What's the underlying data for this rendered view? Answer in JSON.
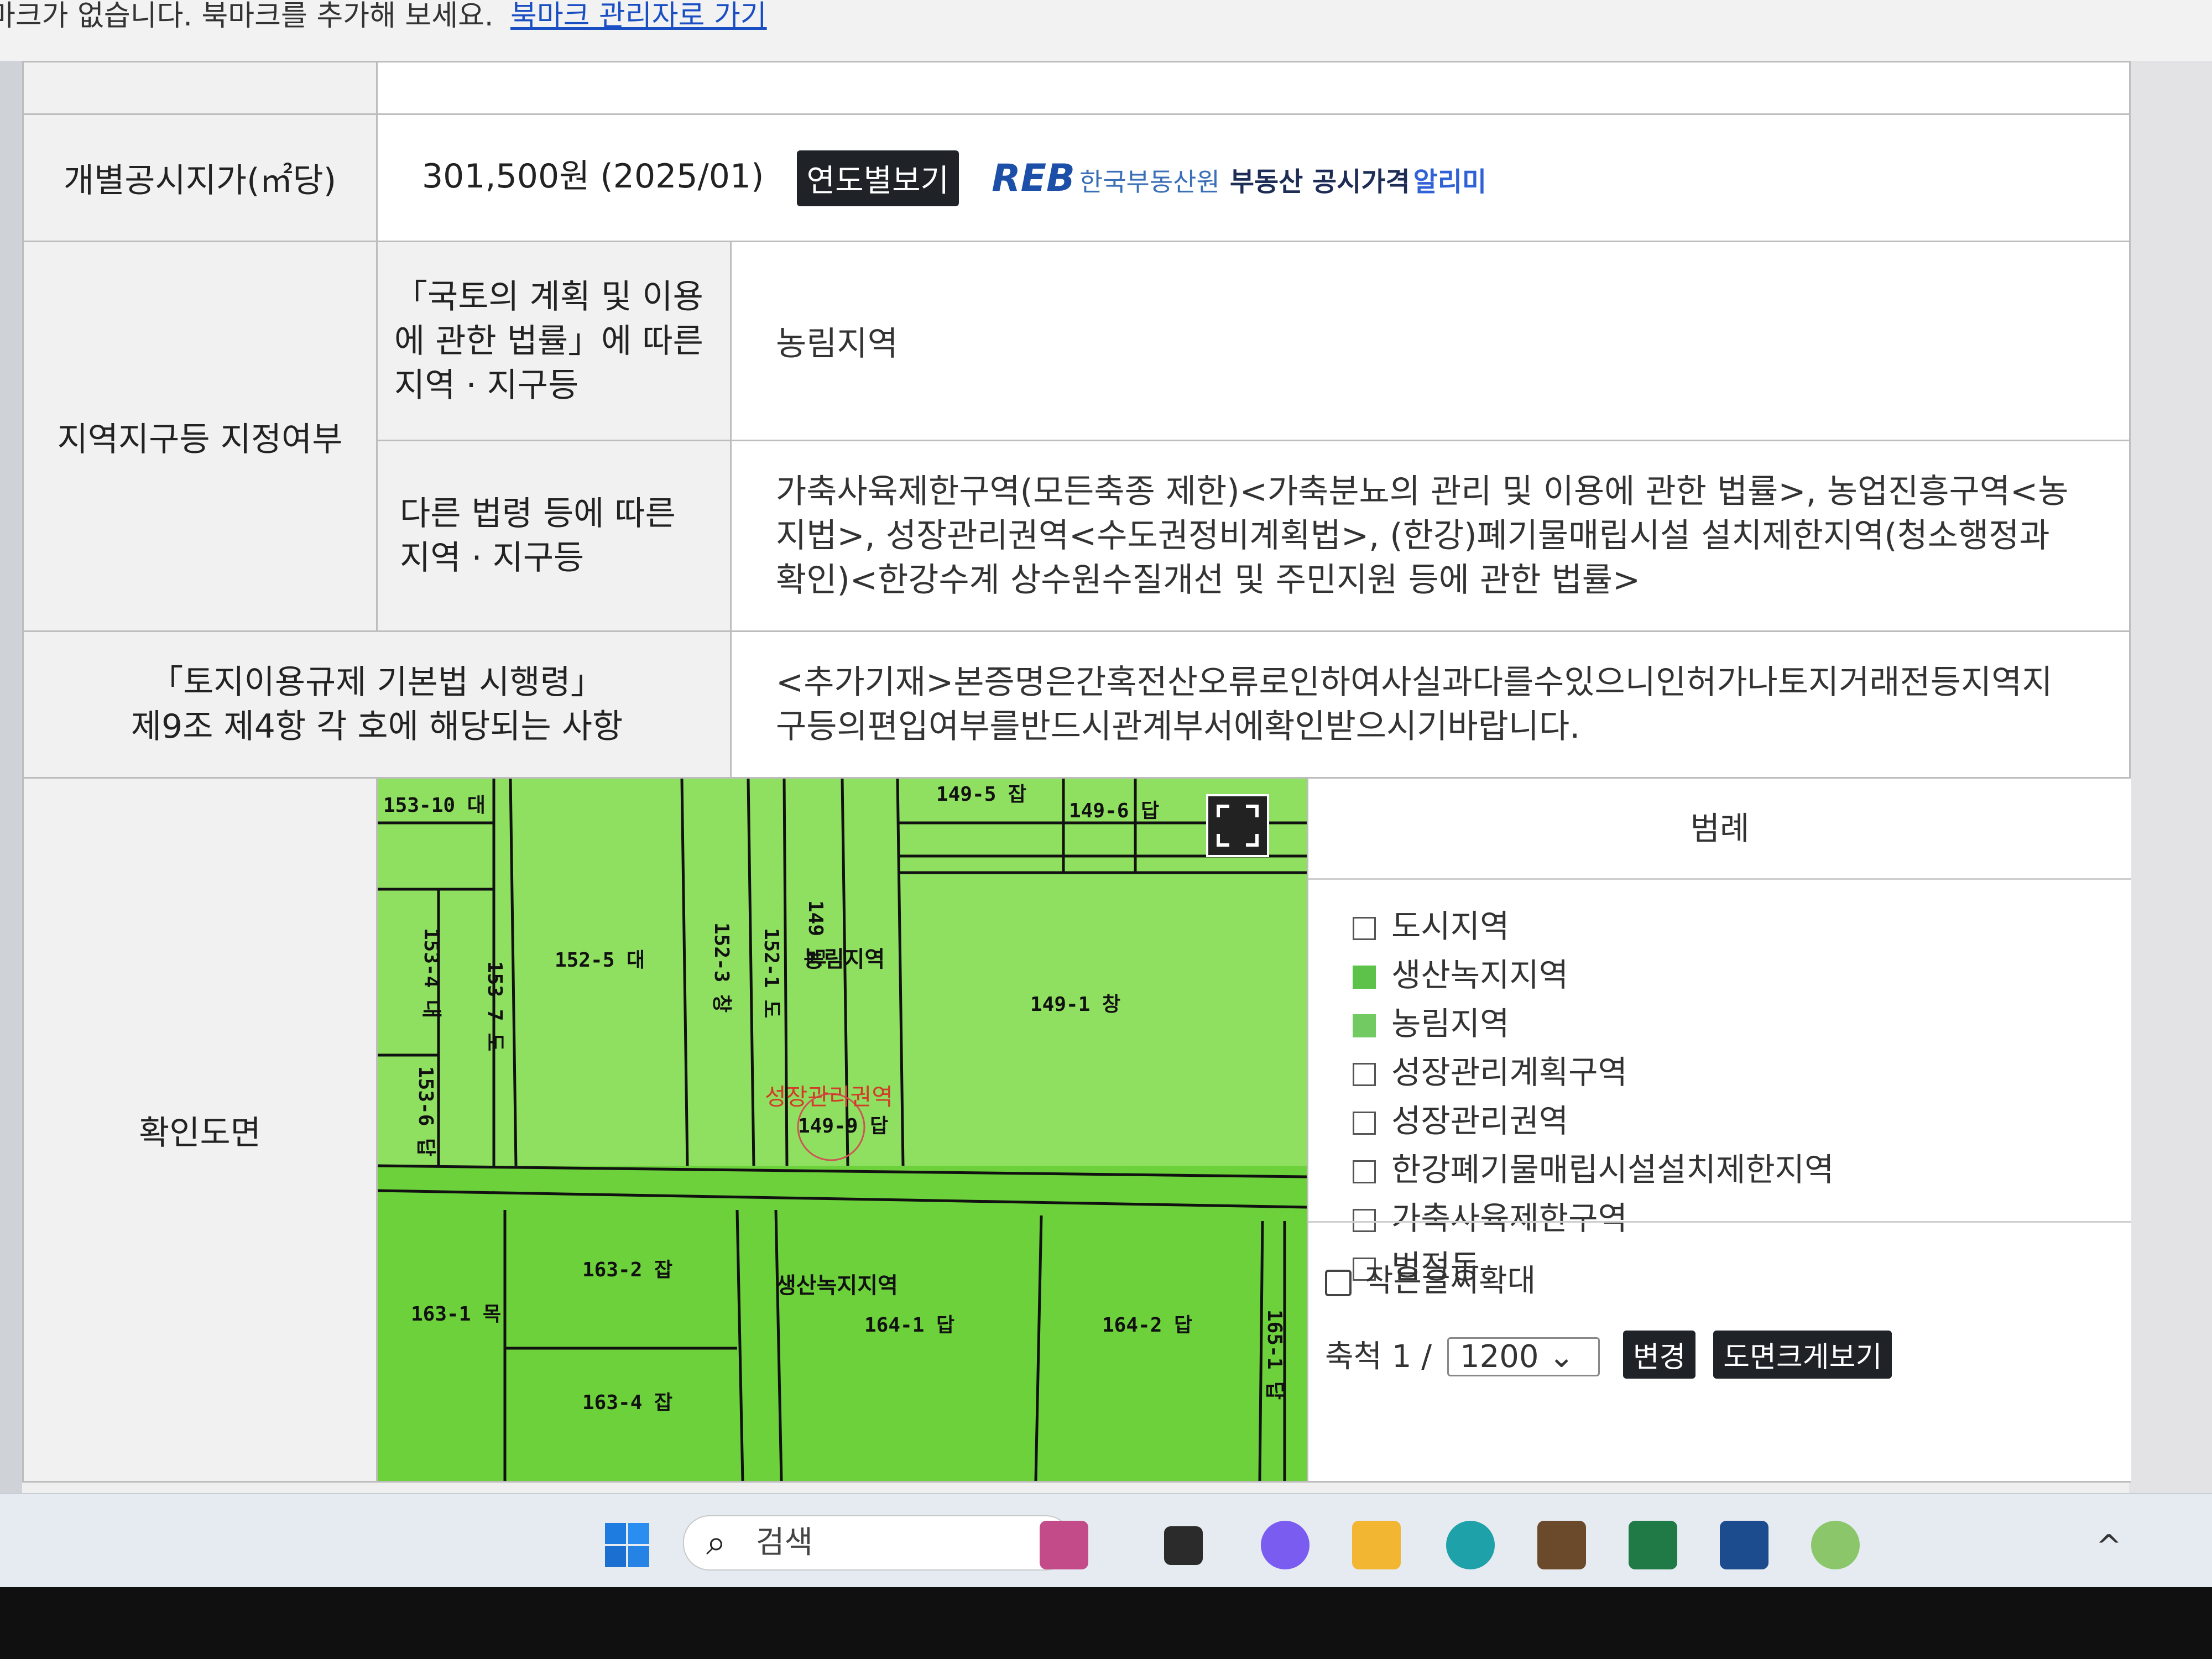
{
  "bookmark_bar": {
    "message": "마크가 없습니다. 북마크를 추가해 보세요.",
    "link": "북마크 관리자로 가기"
  },
  "land": {
    "official_price_label": "개별공시지가(㎡당)",
    "official_price_value": "301,500원 (2025/01)",
    "year_view_button": "연도별보기",
    "reb_logo": "REB",
    "reb_org": "한국부동산원",
    "reb_service": "부동산 공시가격",
    "reb_service_suffix": "알리미",
    "zoning_label": "지역지구등 지정여부",
    "national_law_label": "「국토의 계획 및 이용에 관한 법률」에 따른 지역 · 지구등",
    "national_law_value": "농림지역",
    "other_law_label": "다른 법령 등에 따른 지역 · 지구등",
    "other_law_value": "가축사육제한구역(모든축종 제한)<가축분뇨의 관리 및 이용에 관한 법률>, 농업진흥구역<농지법>, 성장관리권역<수도권정비계획법>, (한강)폐기물매립시설 설치제한지역(청소행정과 확인)<한강수계 상수원수질개선 및 주민지원 등에 관한 법률>",
    "regulation_label_line1": "「토지이용규제 기본법 시행령」",
    "regulation_label_line2": "제9조 제4항 각 호에 해당되는 사항",
    "regulation_value": "<추가기재>본증명은간혹전산오류로인하여사실과다를수있으니인허가나토지거래전등지역지구등의편입여부를반드시관계부서에확인받으시기바랍니다.",
    "map_label": "확인도면"
  },
  "map": {
    "parcels": [
      "153-10 대",
      "152-5 대",
      "152-3 창",
      "152-1 도",
      "149 답",
      "149-5 잡",
      "149-6 답",
      "149-1 창",
      "153-4 대",
      "153-7 도",
      "153-6 답",
      "149-9 답",
      "163-2 잡",
      "163-1 목",
      "163-4 잡",
      "164-1 답",
      "164-2 답",
      "165-1 답"
    ],
    "zone_labels": [
      "농림지역",
      "성장관리권역",
      "생산녹지지역"
    ]
  },
  "legend": {
    "title": "범례",
    "items": [
      {
        "label": "도시지역",
        "color": "#ffffff"
      },
      {
        "label": "생산녹지지역",
        "color": "#5cc24a"
      },
      {
        "label": "농림지역",
        "color": "#72cb62"
      },
      {
        "label": "성장관리계획구역",
        "color": "#ffffff"
      },
      {
        "label": "성장관리권역",
        "color": "#ffffff"
      },
      {
        "label": "한강폐기물매립시설설치제한지역",
        "color": "#ffffff"
      },
      {
        "label": "가축사육제한구역",
        "color": "#ffffff"
      },
      {
        "label": "법정동",
        "color": "#ffffff"
      }
    ],
    "small_text_zoom": "작은글씨확대",
    "scale_label": "축척 1 /",
    "scale_value": "1200",
    "change_button": "변경",
    "enlarge_button": "도면크게보기"
  },
  "taskbar": {
    "search_placeholder": "검색"
  }
}
